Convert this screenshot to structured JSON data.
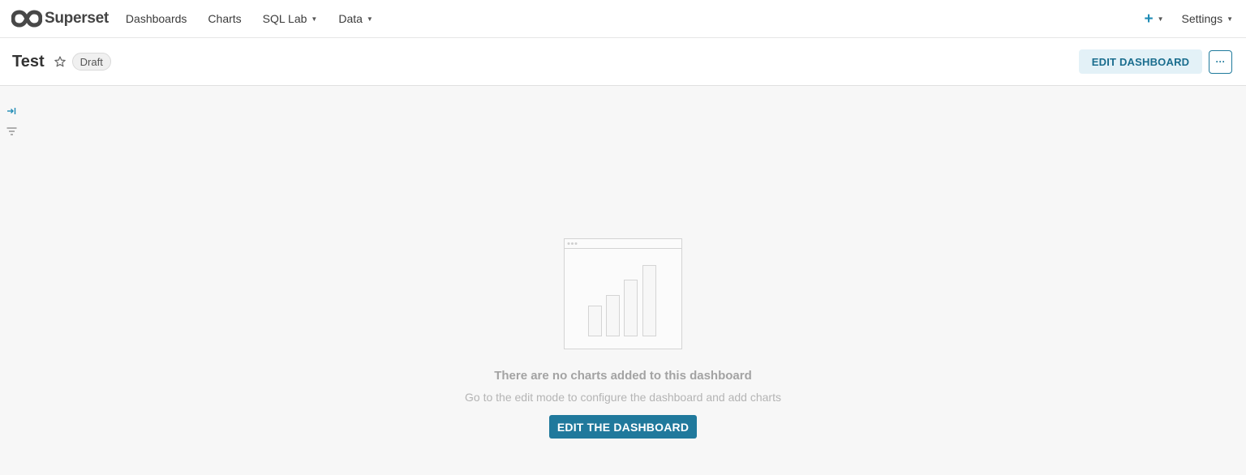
{
  "navbar": {
    "brand": "Superset",
    "items": [
      {
        "label": "Dashboards",
        "has_dropdown": false
      },
      {
        "label": "Charts",
        "has_dropdown": false
      },
      {
        "label": "SQL Lab",
        "has_dropdown": true
      },
      {
        "label": "Data",
        "has_dropdown": true
      }
    ],
    "plus_icon": "plus-icon",
    "settings_label": "Settings",
    "accent_color": "#1f8bb5"
  },
  "header": {
    "title": "Test",
    "status_badge": "Draft",
    "edit_button": "EDIT DASHBOARD",
    "more_button": "···"
  },
  "sidebar": {
    "icons": [
      "expand-icon",
      "filter-icon"
    ]
  },
  "empty_state": {
    "title": "There are no charts added to this dashboard",
    "description": "Go to the edit mode to configure the dashboard and add charts",
    "button": "EDIT THE DASHBOARD",
    "button_color": "#20799c"
  }
}
